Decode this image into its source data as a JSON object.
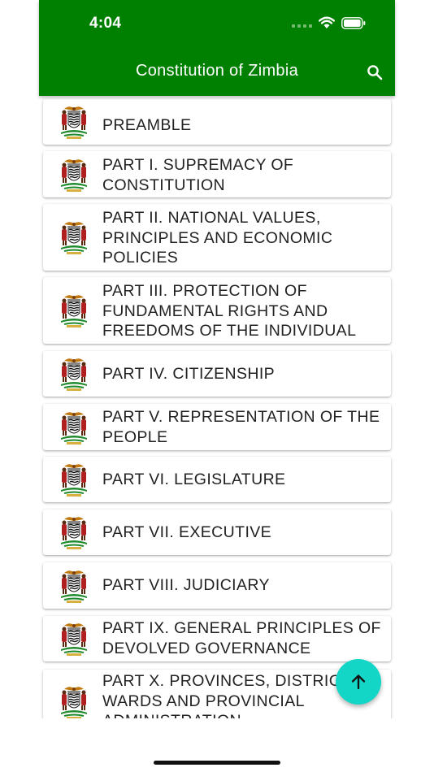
{
  "status_bar": {
    "time": "4:04"
  },
  "app_bar": {
    "title": "Constitution of Zimbia",
    "search_icon": "search-icon"
  },
  "colors": {
    "app_bar": "#008000",
    "fab": "#14d6c7",
    "text": "#222222"
  },
  "items": [
    {
      "label": "PREAMBLE"
    },
    {
      "label": "PART I. SUPREMACY OF CONSTITUTION"
    },
    {
      "label": "PART II. NATIONAL VALUES, PRINCIPLES AND ECONOMIC POLICIES"
    },
    {
      "label": "PART III. PROTECTION OF FUNDAMENTAL RIGHTS AND FREEDOMS OF THE INDIVIDUAL"
    },
    {
      "label": "PART IV. CITIZENSHIP"
    },
    {
      "label": "PART V. REPRESENTATION OF THE PEOPLE"
    },
    {
      "label": "PART VI. LEGISLATURE"
    },
    {
      "label": "PART VII. EXECUTIVE"
    },
    {
      "label": "PART VIII. JUDICIARY"
    },
    {
      "label": "PART IX. GENERAL PRINCIPLES OF DEVOLVED GOVERNANCE"
    },
    {
      "label": "PART X. PROVINCES, DISTRICTS, WARDS AND PROVINCIAL ADMINISTRATION"
    }
  ],
  "fab": {
    "icon": "arrow-up-icon"
  }
}
